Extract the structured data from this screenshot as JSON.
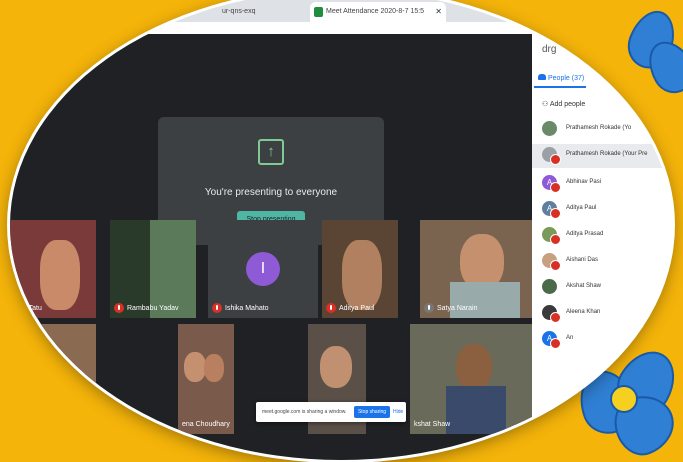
{
  "browser": {
    "tabs": [
      {
        "label": "ur-qns-exq"
      },
      {
        "label": "Meet Attendance 2020-8-7 15:5"
      }
    ]
  },
  "presenting": {
    "message": "You're presenting to everyone",
    "stop_button": "Stop presenting"
  },
  "tiles_row1": [
    {
      "name": "nshi Tatu",
      "color": "#7a3a3a"
    },
    {
      "name": "Rambabu Yadav",
      "color": "#3a4a3a"
    },
    {
      "name": "Ishika Mahato",
      "avatar": "I",
      "color": "#3c4043"
    },
    {
      "name": "Aditya Paul",
      "color": "#5a4434"
    },
    {
      "name": "Satya Narain",
      "color": "#7a6450"
    }
  ],
  "tiles_row2": [
    {
      "name": "",
      "color": "#8a6a50"
    },
    {
      "name": "ena Choudhary",
      "color": "#7a5a4a"
    },
    {
      "name": "",
      "color": "#5a5048"
    },
    {
      "name": "kshat Shaw",
      "color": "#6a6a5a"
    }
  ],
  "share_bar": {
    "text": "meet.google.com is sharing a window.",
    "stop_button": "Stop sharing",
    "hide_label": "Hide"
  },
  "panel": {
    "header_partial": "drg",
    "people_tab": "People (37)",
    "add_people": "Add people",
    "participants": [
      {
        "name": "Prathamesh Rokade (Yo",
        "initial": "",
        "color": "#6a8a6a",
        "muted": false
      },
      {
        "name": "Prathamesh Rokade (Your Pre",
        "initial": "",
        "color": "#9aa0a6",
        "muted": true
      },
      {
        "name": "Abhinav Pasi",
        "initial": "A",
        "color": "#8e5ad6",
        "muted": true
      },
      {
        "name": "Aditya Paul",
        "initial": "A",
        "color": "#5f7fa0",
        "muted": true
      },
      {
        "name": "Aditya Prasad",
        "initial": "",
        "color": "#7a9a5a",
        "muted": true
      },
      {
        "name": "Aishani Das",
        "initial": "",
        "color": "#c8a080",
        "muted": true
      },
      {
        "name": "Akshat Shaw",
        "initial": "",
        "color": "#4a6a4a",
        "muted": false
      },
      {
        "name": "Aleena Khan",
        "initial": "",
        "color": "#3a3a3a",
        "muted": true
      },
      {
        "name": "An",
        "initial": "A",
        "color": "#1a73e8",
        "muted": true
      }
    ]
  }
}
